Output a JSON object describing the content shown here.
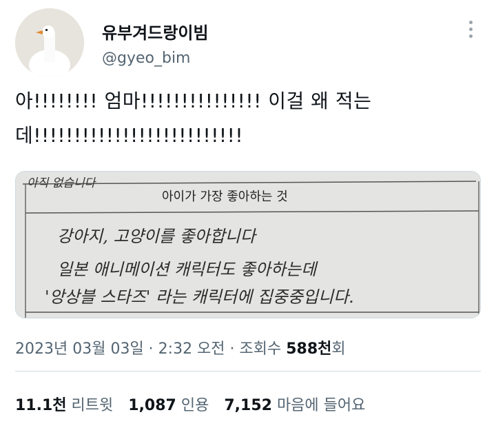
{
  "author": {
    "display_name": "유부겨드랑이빔",
    "handle": "@gyeo_bim",
    "avatar_icon": "goose-avatar-icon"
  },
  "tweet": {
    "text": "아!!!!!!!! 엄마!!!!!!!!!!!!!!! 이걸 왜 적는데!!!!!!!!!!!!!!!!!!!!!!!!!!"
  },
  "media": {
    "header_text": "아이가 가장 좋아하는 것",
    "top_scribble": "아직 없습니다",
    "lines": [
      "강아지, 고양이를 좋아합니다",
      "일본 애니메이션 캐릭터도 좋아하는데",
      "'앙상블 스타즈' 라는 캐릭터에 집중중입니다."
    ]
  },
  "meta": {
    "datetime": "2023년 03월 03일 · 2:32 오전 · 조회수 ",
    "views_count": "588천",
    "views_suffix": "회"
  },
  "stats": {
    "retweets_count": "11.1천",
    "retweets_label": "리트윗",
    "quotes_count": "1,087",
    "quotes_label": "인용",
    "likes_count": "7,152",
    "likes_label": "마음에 들어요"
  }
}
